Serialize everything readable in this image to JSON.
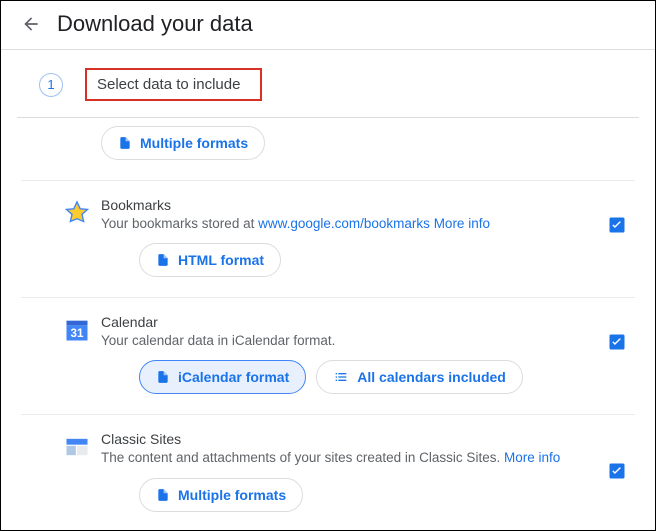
{
  "header": {
    "title": "Download your data"
  },
  "step": {
    "number": "1",
    "title": "Select data to include"
  },
  "top_chip": {
    "label": "Multiple formats"
  },
  "items": [
    {
      "title": "Bookmarks",
      "desc_prefix": "Your bookmarks stored at ",
      "link": "www.google.com/bookmarks",
      "more": "More info",
      "chip": "HTML format"
    },
    {
      "title": "Calendar",
      "desc": "Your calendar data in iCalendar format.",
      "chip": "iCalendar format",
      "chip2": "All calendars included"
    },
    {
      "title": "Classic Sites",
      "desc": "The content and attachments of your sites created in Classic Sites. ",
      "more": "More info",
      "chip": "Multiple formats"
    }
  ]
}
